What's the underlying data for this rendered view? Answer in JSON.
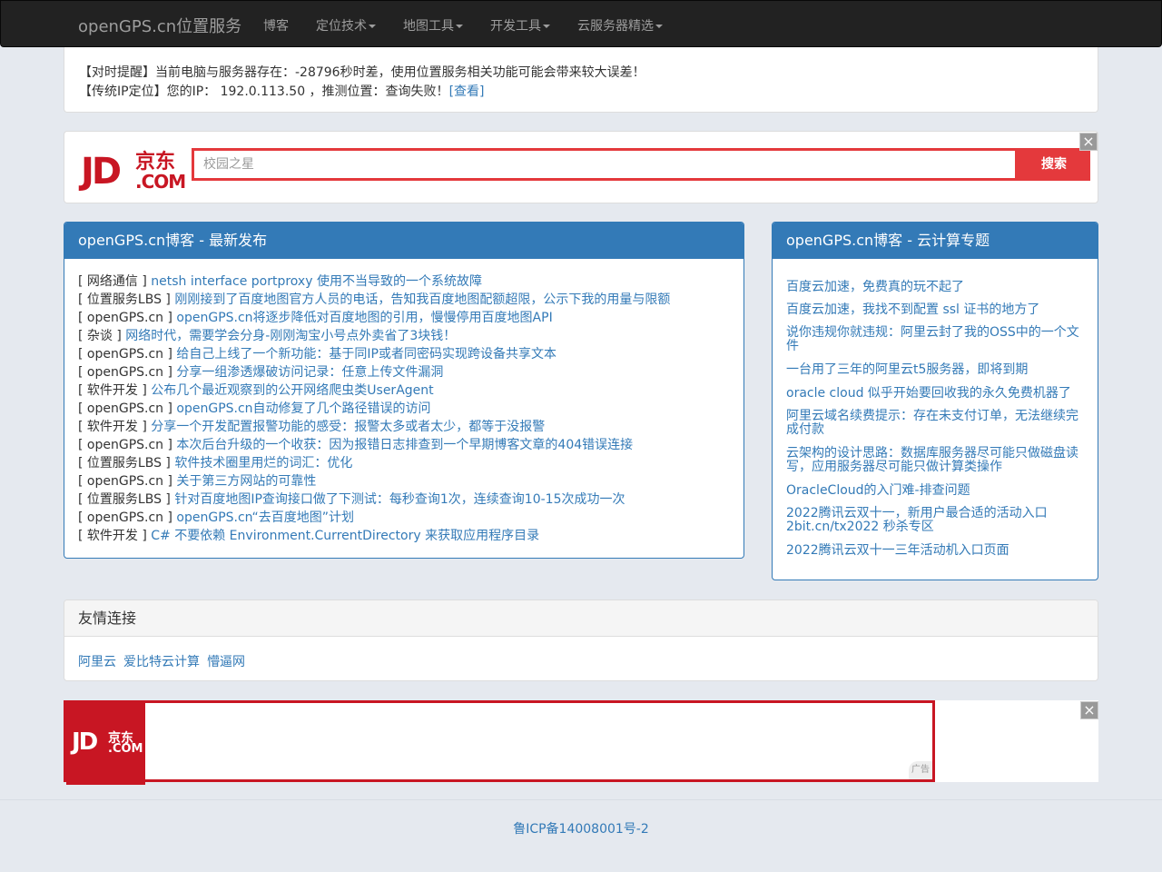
{
  "navbar": {
    "brand": "openGPS.cn位置服务",
    "items": [
      {
        "label": "博客"
      },
      {
        "label": "定位技术"
      },
      {
        "label": "地图工具"
      },
      {
        "label": "开发工具"
      },
      {
        "label": "云服务器精选"
      }
    ]
  },
  "notice": {
    "line1": "【对时提醒】当前电脑与服务器存在：-28796秒时差，使用位置服务相关功能可能会带来较大误差！",
    "line2_prefix": "【传统IP定位】您的IP： 192.0.113.50 ，推测位置：查询失败！",
    "line2_link": "[查看]"
  },
  "jd_ad": {
    "logo_jd": "JD",
    "logo_cn": "京东",
    "logo_com": ".COM",
    "placeholder": "校园之星",
    "search_button": "搜索",
    "close": "×"
  },
  "blog": {
    "title": "openGPS.cn博客 - 最新发布",
    "posts": [
      {
        "cat": "[ 网络通信 ]",
        "title": "netsh interface portproxy 使用不当导致的一个系统故障"
      },
      {
        "cat": "[ 位置服务LBS ]",
        "title": "刚刚接到了百度地图官方人员的电话，告知我百度地图配额超限，公示下我的用量与限额"
      },
      {
        "cat": "[ openGPS.cn ]",
        "title": "openGPS.cn将逐步降低对百度地图的引用，慢慢停用百度地图API"
      },
      {
        "cat": "[ 杂谈 ]",
        "title": "网络时代，需要学会分身-刚刚淘宝小号点外卖省了3块钱！"
      },
      {
        "cat": "[ openGPS.cn ]",
        "title": "给自己上线了一个新功能：基于同IP或者同密码实现跨设备共享文本"
      },
      {
        "cat": "[ openGPS.cn ]",
        "title": "分享一组渗透爆破访问记录：任意上传文件漏洞"
      },
      {
        "cat": "[ 软件开发 ]",
        "title": "公布几个最近观察到的公开网络爬虫类UserAgent"
      },
      {
        "cat": "[ openGPS.cn ]",
        "title": "openGPS.cn自动修复了几个路径错误的访问"
      },
      {
        "cat": "[ 软件开发 ]",
        "title": "分享一个开发配置报警功能的感受：报警太多或者太少，都等于没报警"
      },
      {
        "cat": "[ openGPS.cn ]",
        "title": "本次后台升级的一个收获：因为报错日志排查到一个早期博客文章的404错误连接"
      },
      {
        "cat": "[ 位置服务LBS ]",
        "title": "软件技术圈里用烂的词汇：优化"
      },
      {
        "cat": "[ openGPS.cn ]",
        "title": "关于第三方网站的可靠性"
      },
      {
        "cat": "[ 位置服务LBS ]",
        "title": "针对百度地图IP查询接口做了下测试：每秒查询1次，连续查询10-15次成功一次"
      },
      {
        "cat": "[ openGPS.cn ]",
        "title": "openGPS.cn“去百度地图”计划"
      },
      {
        "cat": "[ 软件开发 ]",
        "title": "C# 不要依赖 Environment.CurrentDirectory 来获取应用程序目录"
      }
    ]
  },
  "cloud": {
    "title": "openGPS.cn博客 - 云计算专题",
    "items": [
      "百度云加速，免费真的玩不起了",
      "百度云加速，我找不到配置 ssl 证书的地方了",
      "说你违规你就违规：阿里云封了我的OSS中的一个文件",
      "一台用了三年的阿里云t5服务器，即将到期",
      "oracle cloud 似乎开始要回收我的永久免费机器了",
      "阿里云域名续费提示：存在未支付订单，无法继续完成付款",
      "云架构的设计思路：数据库服务器尽可能只做磁盘读写，应用服务器尽可能只做计算类操作",
      "OracleCloud的入门难-排查问题",
      "2022腾讯云双十一，新用户最合适的活动入口 2bit.cn/tx2022 秒杀专区",
      "2022腾讯云双十一三年活动机入口页面"
    ]
  },
  "links": {
    "title": "友情连接",
    "items": [
      "阿里云",
      "爱比特云计算",
      "懵逼网"
    ]
  },
  "bottom_ad": {
    "logo_jd": "JD",
    "logo_cn": "京东",
    "logo_com": ".COM",
    "tag": "广告",
    "close": "×"
  },
  "footer": {
    "icp": "鲁ICP备14008001号-2"
  }
}
